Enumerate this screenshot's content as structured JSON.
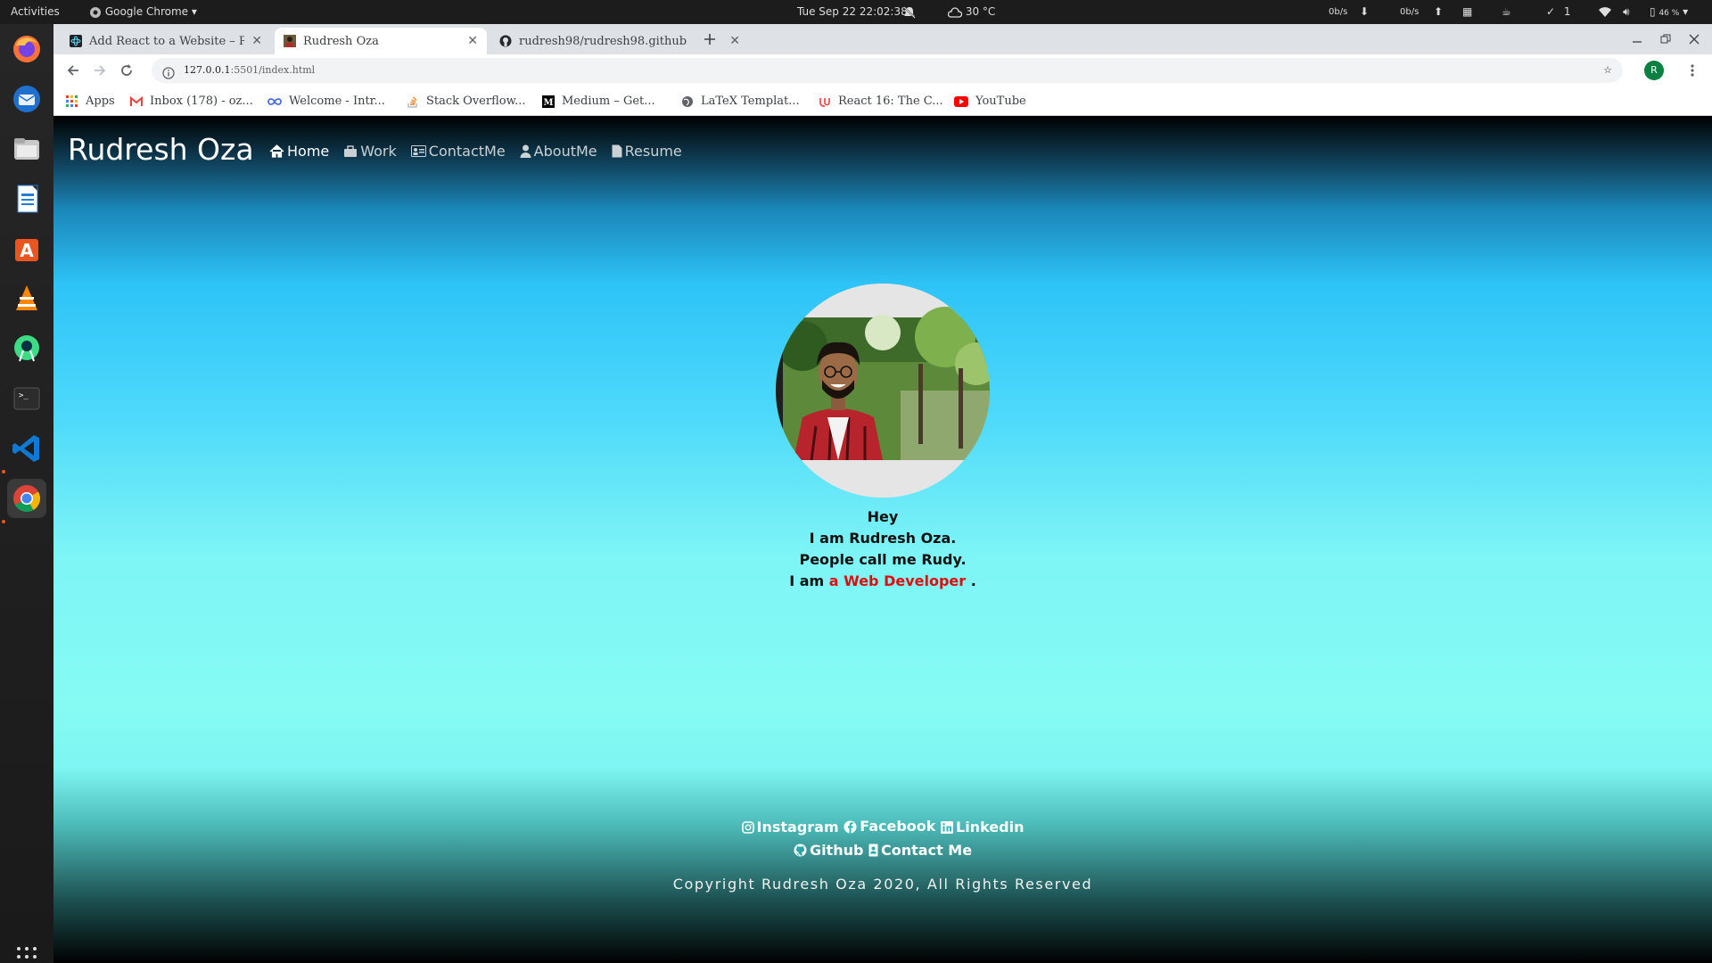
{
  "topbar": {
    "activities": "Activities",
    "app_name": "Google Chrome",
    "datetime": "Tue Sep 22  22:02:38",
    "weather": "30 °C",
    "net_down": "0b/s",
    "net_up": "0b/s",
    "notifications": "1",
    "battery": "46 %"
  },
  "tabs": [
    {
      "title": "Add React to a Website – R",
      "icon": "react-icon"
    },
    {
      "title": "Rudresh Oza",
      "icon": "site-favicon"
    },
    {
      "title": "rudresh98/rudresh98.github",
      "icon": "github-icon"
    }
  ],
  "address": {
    "host": "127.0.0.1",
    "rest": ":5501/index.html"
  },
  "profile_initial": "R",
  "bookmarks": [
    {
      "label": "Apps",
      "icon": "apps-grid-icon"
    },
    {
      "label": "Inbox (178) - oz...",
      "icon": "gmail-icon"
    },
    {
      "label": "Welcome - Intr...",
      "icon": "infinity-icon"
    },
    {
      "label": "Stack Overflow...",
      "icon": "stackoverflow-icon"
    },
    {
      "label": "Medium – Get...",
      "icon": "medium-icon"
    },
    {
      "label": "LaTeX Templat...",
      "icon": "globe-icon"
    },
    {
      "label": "React 16: The C...",
      "icon": "udemy-icon"
    },
    {
      "label": "YouTube",
      "icon": "youtube-icon"
    }
  ],
  "site": {
    "brand": "Rudresh Oza",
    "nav": [
      {
        "label": "Home",
        "icon": "home-icon"
      },
      {
        "label": "Work",
        "icon": "briefcase-icon"
      },
      {
        "label": "ContactMe",
        "icon": "id-card-icon"
      },
      {
        "label": "AboutMe",
        "icon": "user-icon"
      },
      {
        "label": "Resume",
        "icon": "file-icon"
      }
    ],
    "intro": {
      "line1": "Hey",
      "line2": "I am Rudresh Oza.",
      "line3": "People call me Rudy.",
      "line4_prefix": "I am ",
      "line4_highlight": "a Web Developer",
      "line4_suffix": " ."
    },
    "social": [
      {
        "label": "Instagram",
        "icon": "instagram-icon"
      },
      {
        "label": "Facebook",
        "icon": "facebook-icon"
      },
      {
        "label": "Linkedin",
        "icon": "linkedin-icon"
      },
      {
        "label": "Github",
        "icon": "github-icon"
      },
      {
        "label": "Contact Me",
        "icon": "contact-icon"
      }
    ],
    "copyright": "Copyright Rudresh Oza 2020, All Rights Reserved"
  },
  "colors": {
    "highlight": "#e00d0d",
    "nav_active": "#ffffff"
  }
}
